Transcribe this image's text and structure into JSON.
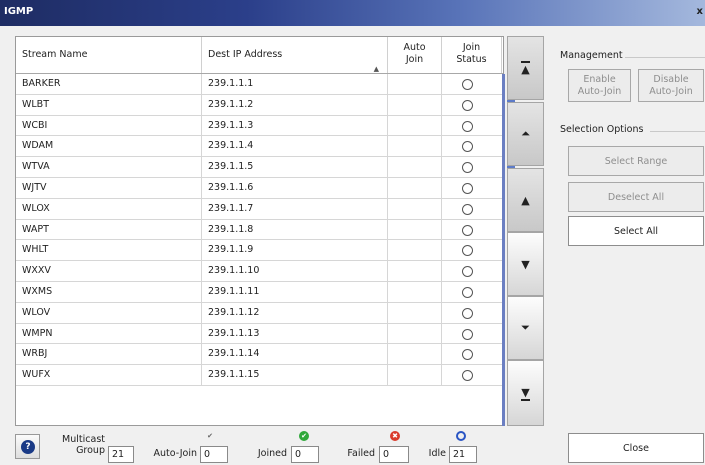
{
  "window": {
    "title": "IGMP",
    "close_glyph": "x"
  },
  "table": {
    "columns": [
      "Stream Name",
      "Dest IP Address",
      "Auto Join",
      "Join Status"
    ],
    "sort_indicator": "▲",
    "rows": [
      {
        "name": "BARKER",
        "ip": "239.1.1.1"
      },
      {
        "name": "WLBT",
        "ip": "239.1.1.2"
      },
      {
        "name": "WCBI",
        "ip": "239.1.1.3"
      },
      {
        "name": "WDAM",
        "ip": "239.1.1.4"
      },
      {
        "name": "WTVA",
        "ip": "239.1.1.5"
      },
      {
        "name": "WJTV",
        "ip": "239.1.1.6"
      },
      {
        "name": "WLOX",
        "ip": "239.1.1.7"
      },
      {
        "name": "WAPT",
        "ip": "239.1.1.8"
      },
      {
        "name": "WHLT",
        "ip": "239.1.1.9"
      },
      {
        "name": "WXXV",
        "ip": "239.1.1.10"
      },
      {
        "name": "WXMS",
        "ip": "239.1.1.11"
      },
      {
        "name": "WLOV",
        "ip": "239.1.1.12"
      },
      {
        "name": "WMPN",
        "ip": "239.1.1.13"
      },
      {
        "name": "WRBJ",
        "ip": "239.1.1.14"
      },
      {
        "name": "WUFX",
        "ip": "239.1.1.15"
      }
    ]
  },
  "navigation": [
    {
      "name": "scroll-top-button",
      "icon": "double-bar-up-icon",
      "glyph": "▲"
    },
    {
      "name": "page-up-button",
      "icon": "double-up-icon",
      "glyph": "⏶"
    },
    {
      "name": "line-up-button",
      "icon": "up-icon",
      "glyph": "▲"
    },
    {
      "name": "line-down-button",
      "icon": "down-icon",
      "glyph": "▼"
    },
    {
      "name": "page-down-button",
      "icon": "double-down-icon",
      "glyph": "⏷"
    },
    {
      "name": "scroll-bottom-button",
      "icon": "double-bar-down-icon",
      "glyph": "▼"
    }
  ],
  "management": {
    "label": "Management",
    "enable_label": "Enable Auto-Join",
    "disable_label": "Disable Auto-Join"
  },
  "selection": {
    "label": "Selection Options",
    "select_range": "Select Range",
    "deselect_all": "Deselect All",
    "select_all": "Select All"
  },
  "status": {
    "multicast_label": "Multicast Group",
    "multicast_value": "21",
    "autojoin_label": "Auto-Join",
    "autojoin_value": "0",
    "joined_label": "Joined",
    "joined_value": "0",
    "failed_label": "Failed",
    "failed_value": "0",
    "idle_label": "Idle",
    "idle_value": "21",
    "help_glyph": "?"
  },
  "footer": {
    "close_label": "Close"
  },
  "colors": {
    "accent": "#5d7bc8",
    "joined": "#2fa83a",
    "failed": "#d93a2a",
    "idle": "#2a55c4"
  }
}
